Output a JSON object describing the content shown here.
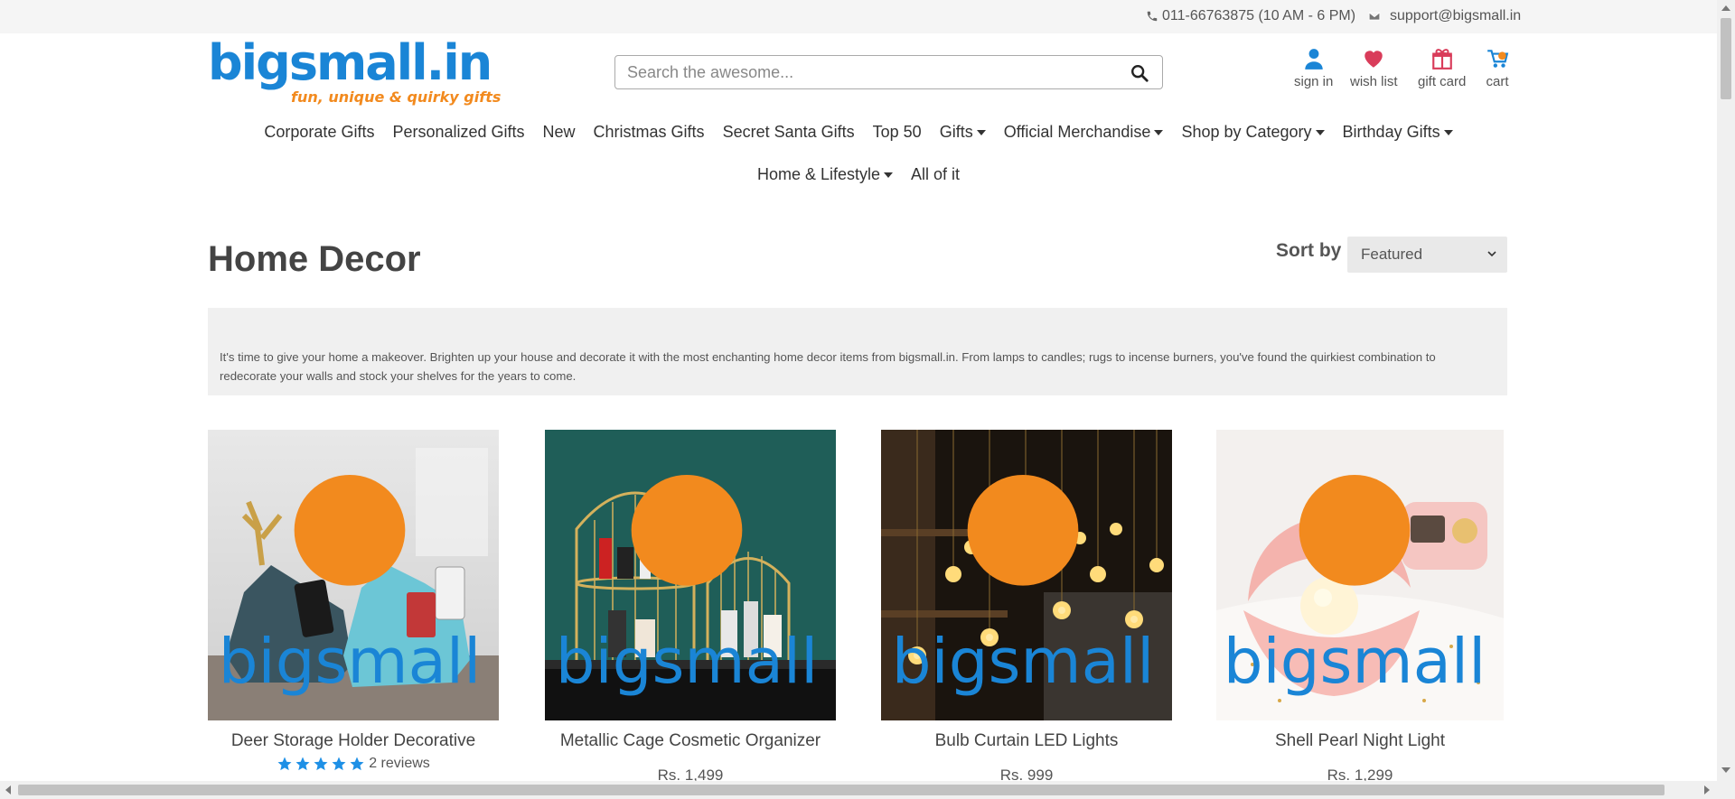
{
  "topbar": {
    "phone": "011-66763875 (10 AM - 6 PM)",
    "email": "support@bigsmall.in",
    "phone_icon": "phone-icon",
    "email_icon": "envelope-icon"
  },
  "brand": {
    "logo_text": "bigsmall.in",
    "tagline": "fun, unique & quirky gifts",
    "primary_color": "#1a85d6",
    "accent_color": "#f28a1e"
  },
  "search": {
    "placeholder": "Search the awesome...",
    "value": "",
    "icon": "search-icon"
  },
  "account": {
    "sign_in": "sign in",
    "wish_list": "wish list",
    "gift_card": "gift card",
    "cart": "cart"
  },
  "nav": {
    "row1": [
      {
        "label": "Corporate Gifts",
        "dropdown": false
      },
      {
        "label": "Personalized Gifts",
        "dropdown": false
      },
      {
        "label": "New",
        "dropdown": false
      },
      {
        "label": "Christmas Gifts",
        "dropdown": false
      },
      {
        "label": "Secret Santa Gifts",
        "dropdown": false
      },
      {
        "label": "Top 50",
        "dropdown": false
      },
      {
        "label": "Gifts",
        "dropdown": true
      },
      {
        "label": "Official Merchandise",
        "dropdown": true
      },
      {
        "label": "Shop by Category",
        "dropdown": true
      },
      {
        "label": "Birthday Gifts",
        "dropdown": true
      }
    ],
    "row2": [
      {
        "label": "Home & Lifestyle",
        "dropdown": true
      },
      {
        "label": "All of it",
        "dropdown": false
      }
    ]
  },
  "page": {
    "title": "Home Decor",
    "sort_label": "Sort by",
    "sort_value": "Featured",
    "description": "It's time to give your home a makeover. Brighten up your house and decorate it with the most enchanting home decor items from bigsmall.in. From lamps to candles; rugs to incense burners, you've found the quirkiest combination to redecorate your walls and stock your shelves for the years to come."
  },
  "products": [
    {
      "name": "Deer Storage Holder Decorative",
      "rating": 5,
      "reviews": "2 reviews",
      "price": "",
      "image": "deer-storage-holder-image"
    },
    {
      "name": "Metallic Cage Cosmetic Organizer",
      "reviews": "",
      "price": "Rs. 1,499",
      "image": "cage-organizer-image"
    },
    {
      "name": "Bulb Curtain LED Lights",
      "reviews": "",
      "price": "Rs. 999",
      "image": "bulb-curtain-lights-image"
    },
    {
      "name": "Shell Pearl Night Light",
      "reviews": "",
      "price": "Rs. 1,299",
      "image": "shell-pearl-light-image"
    }
  ]
}
